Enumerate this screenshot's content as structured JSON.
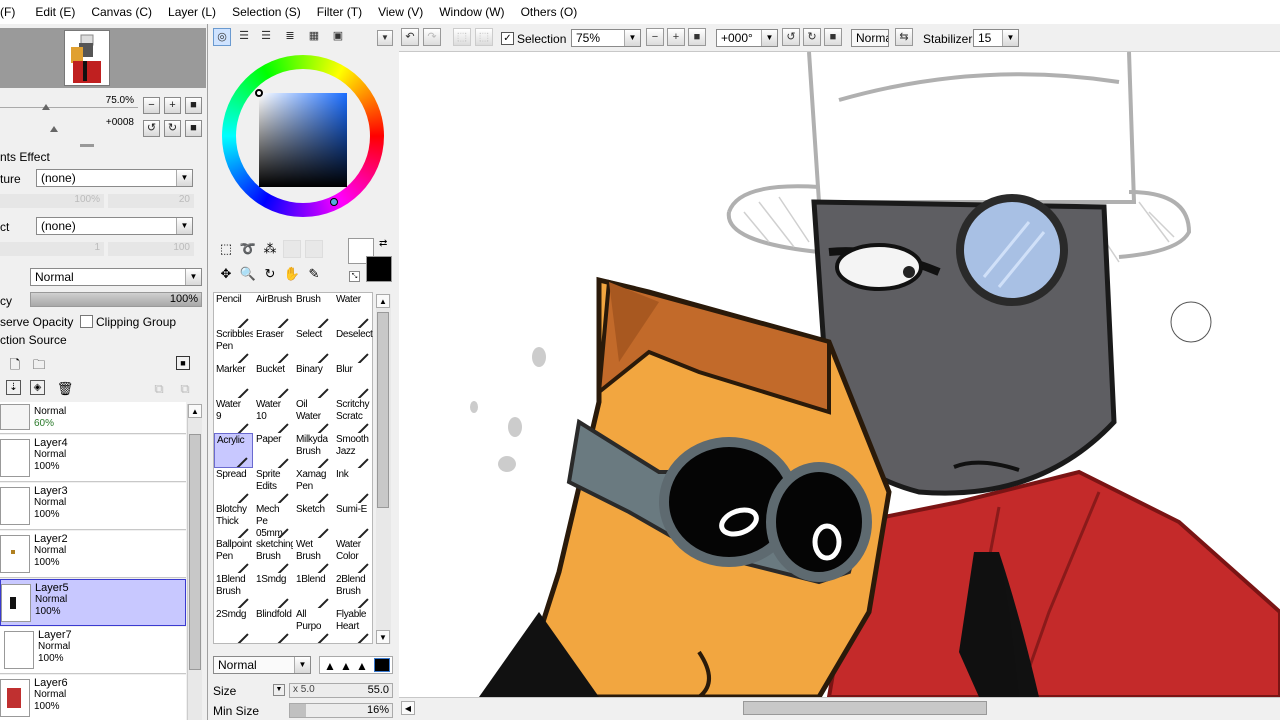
{
  "menu": {
    "items": [
      "(F)",
      "Edit (E)",
      "Canvas (C)",
      "Layer (L)",
      "Selection (S)",
      "Filter (T)",
      "View (V)",
      "Window (W)",
      "Others (O)"
    ]
  },
  "navigator": {
    "zoom": "75.0%",
    "angle": "+0008"
  },
  "effects": {
    "title": "nts Effect",
    "texture_label": "ture",
    "texture_value": "(none)",
    "texture_pct": "100%",
    "texture_num": "20",
    "effect_label": "ct",
    "effect_value": "(none)",
    "effect_num1": "1",
    "effect_num2": "100"
  },
  "layer_props": {
    "blend_mode": "Normal",
    "opacity_label": "cy",
    "opacity_value": "100%",
    "preserve_opacity": "serve Opacity",
    "clipping_group": "Clipping Group",
    "selection_source": "ction Source"
  },
  "layers": [
    {
      "name": "",
      "mode": "Normal",
      "opacity": "60%"
    },
    {
      "name": "Layer4",
      "mode": "Normal",
      "opacity": "100%"
    },
    {
      "name": "Layer3",
      "mode": "Normal",
      "opacity": "100%"
    },
    {
      "name": "Layer2",
      "mode": "Normal",
      "opacity": "100%"
    },
    {
      "name": "Layer5",
      "mode": "Normal",
      "opacity": "100%",
      "selected": true
    },
    {
      "name": "Layer7",
      "mode": "Normal",
      "opacity": "100%"
    },
    {
      "name": "Layer6",
      "mode": "Normal",
      "opacity": "100%"
    }
  ],
  "tools": [
    [
      "Pencil",
      ""
    ],
    [
      "AirBrush",
      ""
    ],
    [
      "Brush",
      ""
    ],
    [
      "Water",
      ""
    ],
    [
      "Scribbles",
      "Pen"
    ],
    [
      "Eraser",
      ""
    ],
    [
      "Select",
      ""
    ],
    [
      "Deselect",
      ""
    ],
    [
      "Marker",
      ""
    ],
    [
      "Bucket",
      ""
    ],
    [
      "Binary",
      ""
    ],
    [
      "Blur",
      ""
    ],
    [
      "Water",
      "9"
    ],
    [
      "Water",
      "10"
    ],
    [
      "Oil Water",
      ""
    ],
    [
      "Scritchy",
      "Scratc"
    ],
    [
      "Acrylic",
      ""
    ],
    [
      "Paper",
      ""
    ],
    [
      "Milkyda",
      "Brush"
    ],
    [
      "Smooth",
      "Jazz"
    ],
    [
      "Spread",
      ""
    ],
    [
      "Sprite",
      "Edits"
    ],
    [
      "Xamag",
      "Pen"
    ],
    [
      "Ink",
      ""
    ],
    [
      "Blotchy",
      "Thick"
    ],
    [
      "Mech Pe",
      "05mm"
    ],
    [
      "Sketch",
      ""
    ],
    [
      "Sumi-E",
      ""
    ],
    [
      "Ballpoint",
      "Pen"
    ],
    [
      "sketching",
      "Brush"
    ],
    [
      "Wet",
      "Brush"
    ],
    [
      "Water",
      "Color"
    ],
    [
      "1Blend",
      "Brush"
    ],
    [
      "1Smdg",
      ""
    ],
    [
      "1Blend",
      ""
    ],
    [
      "2Blend",
      "Brush"
    ],
    [
      "2Smdg",
      ""
    ],
    [
      "Blindfold",
      ""
    ],
    [
      "All",
      "Purpo"
    ],
    [
      "Flyable",
      "Heart"
    ]
  ],
  "brush_settings": {
    "blend_mode": "Normal",
    "size_label": "Size",
    "size_mult": "x 5.0",
    "size_value": "55.0",
    "min_size_label": "Min Size",
    "min_size_value": "16%"
  },
  "toolbar": {
    "selection_label": "Selection",
    "zoom": "75%",
    "rotation": "+000°",
    "blend": "Normal",
    "stabilizer_label": "Stabilizer",
    "stabilizer_value": "15"
  },
  "colors": {
    "primary": "#000000",
    "secondary": "#ffffff",
    "selected_layer": "#c8c8ff"
  }
}
